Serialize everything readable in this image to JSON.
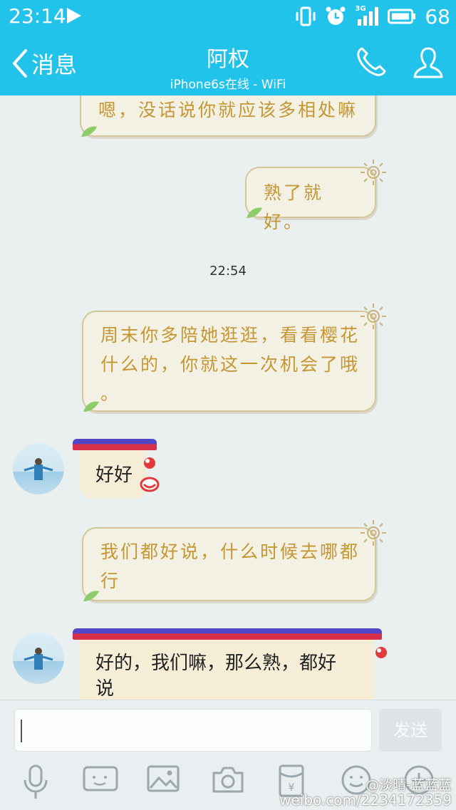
{
  "status_bar": {
    "time": "23:14",
    "network": "3G",
    "battery": "68"
  },
  "header": {
    "back_label": "消息",
    "title": "阿权",
    "subtitle": "iPhone6s在线 - WiFi"
  },
  "messages": [
    {
      "side": "right",
      "text": "嗯，没话说你就应该多相处嘛"
    },
    {
      "side": "right",
      "text": "熟了就好。"
    },
    {
      "type": "time",
      "text": "22:54"
    },
    {
      "side": "right",
      "lines": [
        "周末你多陪她逛逛，看看樱花",
        "什么的，你就这一次机会了哦",
        "。"
      ]
    },
    {
      "side": "left",
      "text": "好好"
    },
    {
      "side": "right",
      "lines": [
        "我们都好说，什么时候去哪都",
        "行"
      ]
    },
    {
      "side": "left",
      "lines": [
        "好的，我们嘛，那么熟，都好",
        "说"
      ]
    }
  ],
  "input": {
    "value": "",
    "send_label": "发送"
  },
  "toolbar": [
    "microphone-icon",
    "video-icon",
    "image-icon",
    "camera-icon",
    "red-packet-icon",
    "emoji-icon",
    "plus-icon"
  ],
  "watermark": {
    "handle": "@淡晴-蓝蓝蓝",
    "url": "weibo.com/2234172359"
  },
  "colors": {
    "header_bg": "#22c3ea",
    "chat_bg": "#eaeff0",
    "bubble_text": "#c59732"
  }
}
